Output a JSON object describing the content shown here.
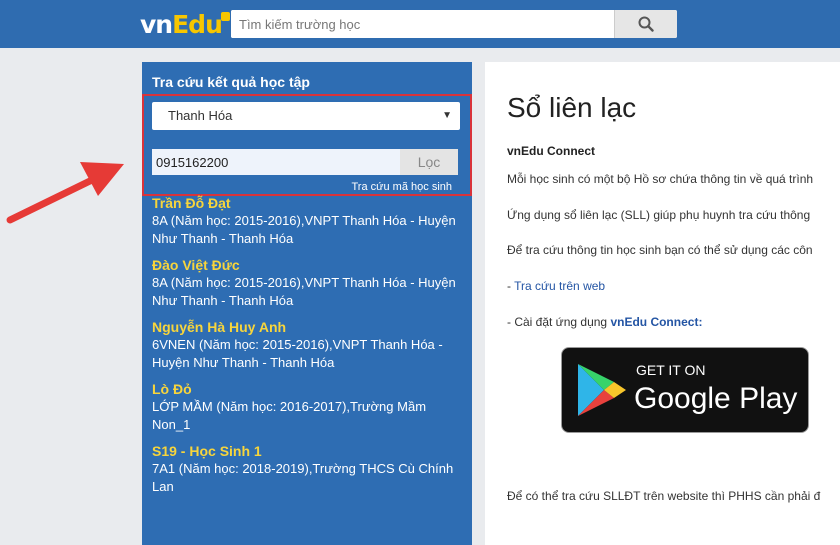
{
  "header": {
    "logo_vn": "vn",
    "logo_edu": "Edu",
    "search_placeholder": "Tìm kiếm trường học"
  },
  "colors": {
    "header_bg": "#2f6cb0",
    "panel_bg": "#2e6db3",
    "highlight_border": "#d9333a",
    "name_color": "#f7d53c",
    "link_color": "#2455a4"
  },
  "lookup": {
    "title": "Tra cứu kết quả học tập",
    "province": "Thanh Hóa",
    "phone": "0915162200",
    "filter_label": "Lọc",
    "lookup_by_code": "Tra cứu mã học sinh"
  },
  "results": [
    {
      "name": "Trần Đỗ Đạt",
      "detail": "8A (Năm học: 2015-2016),VNPT Thanh Hóa - Huyện Như Thanh - Thanh Hóa"
    },
    {
      "name": "Đào Việt Đức",
      "detail": "8A (Năm học: 2015-2016),VNPT Thanh Hóa - Huyện Như Thanh - Thanh Hóa"
    },
    {
      "name": "Nguyễn Hà Huy Anh",
      "detail": "6VNEN (Năm học: 2015-2016),VNPT Thanh Hóa - Huyện Như Thanh - Thanh Hóa"
    },
    {
      "name": "Lò Đỏ",
      "detail": "LỚP MẦM (Năm học: 2016-2017),Trường Mầm Non_1"
    },
    {
      "name": "S19 - Học Sinh 1",
      "detail": "7A1 (Năm học: 2018-2019),Trường THCS Cù Chính Lan"
    }
  ],
  "right": {
    "title": "Sổ liên lạc",
    "subhead": "vnEdu Connect",
    "line1": "Mỗi học sinh có một bộ Hồ sơ chứa thông tin về quá trình",
    "line2": "Ứng dụng sổ liên lạc (SLL) giúp phụ huynh tra cứu thông",
    "line3": "Để tra cứu thông tin học sinh bạn có thể sử dụng các côn",
    "web_prefix": "- ",
    "web_link": "Tra cứu trên web",
    "app_prefix": "- Cài đặt ứng dụng ",
    "app_link": "vnEdu Connect:",
    "gplay_get": "GET IT ON",
    "gplay_name": "Google Play",
    "footer_line": "Để có thể tra cứu SLLĐT trên website thì PHHS cần phải đ"
  }
}
